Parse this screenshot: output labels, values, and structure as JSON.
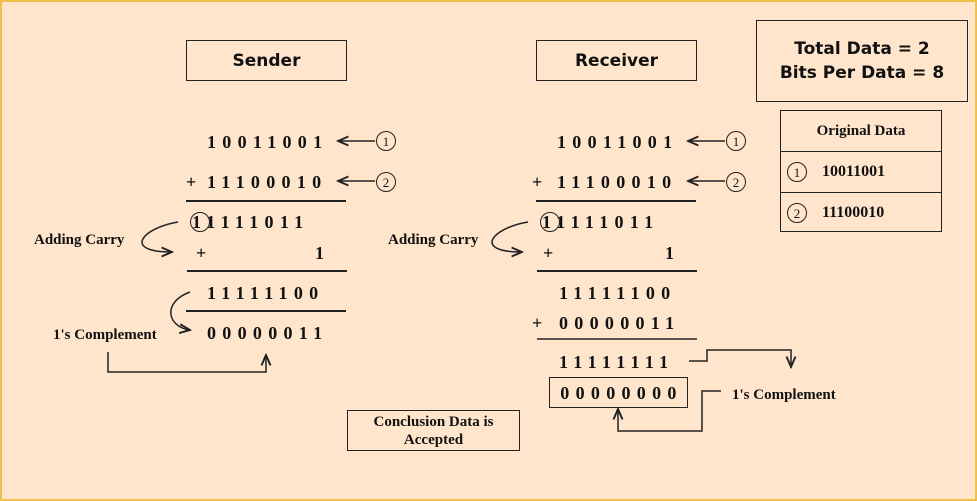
{
  "sender": {
    "title": "Sender",
    "data1": "10011001",
    "data2": "11100010",
    "plus": "+",
    "sum": "11111011",
    "carry": "1",
    "sum_with_carry": "11111100",
    "complement": "00000011",
    "adding_carry_label": "Adding Carry",
    "complement_label": "1's Complement",
    "marker1": "1",
    "marker2": "2"
  },
  "receiver": {
    "title": "Receiver",
    "data1": "10011001",
    "data2": "11100010",
    "plus": "+",
    "sum": "11111011",
    "carry": "1",
    "sum_with_carry": "11111100",
    "checksum": "00000011",
    "total": "11111111",
    "complement": "00000000",
    "adding_carry_label": "Adding Carry",
    "complement_label": "1's Complement",
    "marker1": "1",
    "marker2": "2"
  },
  "info": {
    "line1": "Total Data = 2",
    "line2": "Bits Per Data = 8"
  },
  "original_data": {
    "header": "Original Data",
    "rows": [
      {
        "marker": "1",
        "value": "10011001"
      },
      {
        "marker": "2",
        "value": "11100010"
      }
    ]
  },
  "conclusion": {
    "line1": "Conclusion Data is",
    "line2": "Accepted"
  }
}
